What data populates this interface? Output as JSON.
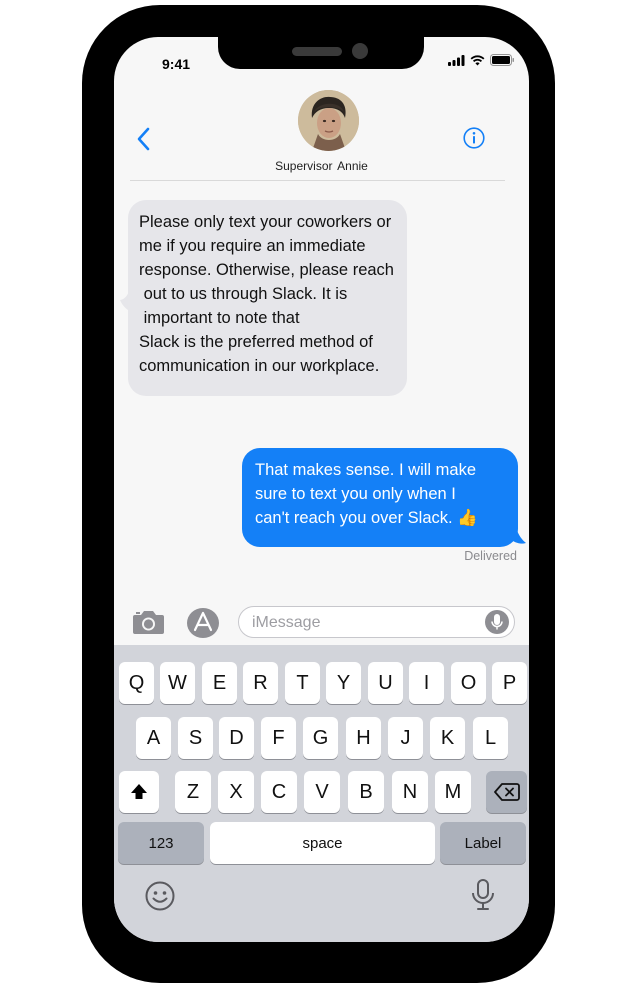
{
  "status_bar": {
    "time": "9:41"
  },
  "header": {
    "contact_name": "Supervisor  Annie",
    "back_icon": "chevron-left-icon",
    "info_icon": "info-icon",
    "accent": "#1480f7"
  },
  "messages": [
    {
      "direction": "incoming",
      "text": "Please only text your coworkers or\nme if you require an immediate\nresponse. Otherwise, please reach\n out to us through Slack. It is\n important to note that\nSlack is the preferred method of\ncommunication in our workplace."
    },
    {
      "direction": "outgoing",
      "text": "That makes sense. I will make\nsure to text you only when I\ncan't reach you over Slack. 👍",
      "status": "Delivered"
    }
  ],
  "composer": {
    "placeholder": "iMessage",
    "camera_icon": "camera-icon",
    "appstore_icon": "app-store-icon",
    "mic_icon": "microphone-icon"
  },
  "keyboard": {
    "row1": [
      "Q",
      "W",
      "E",
      "R",
      "T",
      "Y",
      "U",
      "I",
      "O",
      "P"
    ],
    "row2": [
      "A",
      "S",
      "D",
      "F",
      "G",
      "H",
      "J",
      "K",
      "L"
    ],
    "row3": [
      "Z",
      "X",
      "C",
      "V",
      "B",
      "N",
      "M"
    ],
    "numbers_label": "123",
    "space_label": "space",
    "return_label": "Label",
    "shift_icon": "shift-icon",
    "delete_icon": "backspace-icon",
    "emoji_icon": "emoji-icon",
    "dictation_icon": "microphone-icon"
  },
  "colors": {
    "incoming_bubble": "#e6e6ea",
    "outgoing_bubble": "#1480f7",
    "keyboard_bg": "#d2d4da"
  }
}
